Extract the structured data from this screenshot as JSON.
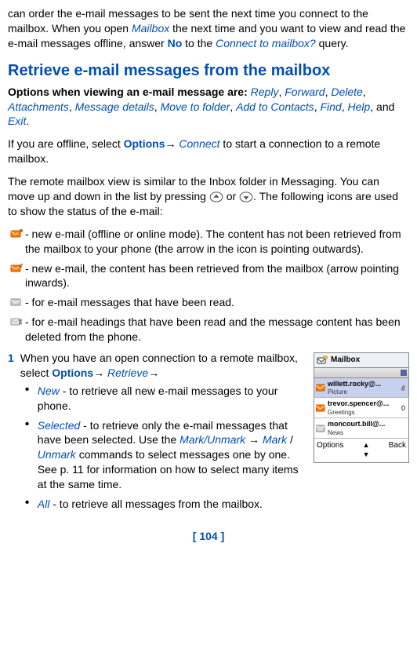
{
  "para_top": {
    "t1": "can order the e-mail messages to be sent the next time you connect to the mailbox. When you open ",
    "mailbox": "Mailbox",
    "t2": " the next time and you want to view and read the e-mail messages offline, answer ",
    "no": "No",
    "t3": " to the ",
    "connect_q": "Connect to mailbox?",
    "t4": " query."
  },
  "heading": "Retrieve e-mail messages from the mailbox",
  "opts_line": {
    "lead": "Options when viewing an e-mail message are: ",
    "reply": "Reply",
    "forward": "Forward",
    "delete": "Delete",
    "attachments": "Attachments",
    "msgdetails": "Message details",
    "move": "Move to folder",
    "addcontacts": "Add to Contacts",
    "find": "Find",
    "help": "Help",
    "and": ", and ",
    "exit": "Exit",
    "sep": ", "
  },
  "offline": {
    "t1": "If you are offline, select ",
    "options": "Options",
    "arrow": "→ ",
    "connect": "Connect",
    "t2": " to start a connection to a remote mailbox."
  },
  "view_intro": "The remote mailbox view is similar to the Inbox folder in Messaging. You can move up and down in the list by pressing ",
  "view_or": " or ",
  "view_tail": ". The following icons are used to show the status of the e-mail:",
  "icons": {
    "a": " - new e-mail (offline or online mode). The content has not been retrieved from the mailbox to your phone (the arrow in the icon is pointing outwards).",
    "b": " - new e-mail, the content has been retrieved from the mailbox (arrow pointing inwards).",
    "c": " - for e-mail messages that have been read.",
    "d": " - for e-mail headings that have been read and the message content has been deleted from the phone."
  },
  "step": {
    "num": "1",
    "t1": "When you have an open connection to a remote mailbox, select ",
    "options": "Options",
    "arrow1": "→ ",
    "retrieve": "Retrieve",
    "arrow2": "→"
  },
  "bullets": {
    "new_l": "New",
    "new_t": " - to retrieve all new e-mail messages to your phone.",
    "sel_l": "Selected",
    "sel_t1": " - to retrieve only the e-mail messages that have been selected. Use the ",
    "markunmark": "Mark/Unmark",
    "sel_arrow": " → ",
    "mark": "Mark",
    "slash": " / ",
    "unmark": "Unmark",
    "sel_t2": " commands to select messages one by one. See p. 11 for information on how to select many items at the same time.",
    "all_l": "All",
    "all_t": " - to retrieve all messages from the mailbox."
  },
  "phone": {
    "title": "Mailbox",
    "m1_from": "willett.rocky@...",
    "m1_sub": "Picture",
    "m2_from": "trevor.spencer@...",
    "m2_sub": "Greetings",
    "m2_count": "0",
    "m3_from": "moncourt.bill@...",
    "m3_sub": "News",
    "sk_left": "Options",
    "sk_right": "Back"
  },
  "page_num": "[ 104 ]"
}
